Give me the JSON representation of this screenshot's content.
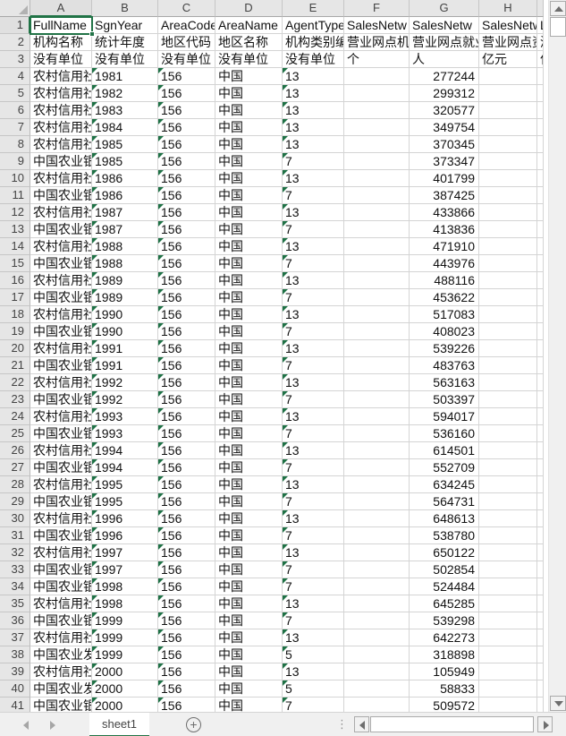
{
  "grid": {
    "column_letters": [
      "A",
      "B",
      "C",
      "D",
      "E",
      "F",
      "G",
      "H"
    ],
    "selected_cell": "A1",
    "rows_visible": {
      "first": 1,
      "last": 41
    },
    "field_row": [
      "FullName",
      "SgnYear",
      "AreaCode",
      "AreaName",
      "AgentType",
      "SalesNetw",
      "SalesNetw",
      "SalesNetw",
      "L"
    ],
    "label_row": [
      "机构名称",
      "统计年度",
      "地区代码",
      "地区名称",
      "机构类别编码",
      "营业网点机构数",
      "营业网点就业人数",
      "营业网点资产",
      "涉"
    ],
    "unit_row": [
      "没有单位",
      "没有单位",
      "没有单位",
      "没有单位",
      "没有单位",
      "个",
      "人",
      "亿元",
      "亿"
    ],
    "data_rows": [
      [
        "农村信用社",
        "1981",
        "156",
        "中国",
        "13",
        "",
        "277244",
        "",
        ""
      ],
      [
        "农村信用社",
        "1982",
        "156",
        "中国",
        "13",
        "",
        "299312",
        "",
        ""
      ],
      [
        "农村信用社",
        "1983",
        "156",
        "中国",
        "13",
        "",
        "320577",
        "",
        ""
      ],
      [
        "农村信用社",
        "1984",
        "156",
        "中国",
        "13",
        "",
        "349754",
        "",
        ""
      ],
      [
        "农村信用社",
        "1985",
        "156",
        "中国",
        "13",
        "",
        "370345",
        "",
        ""
      ],
      [
        "中国农业银行",
        "1985",
        "156",
        "中国",
        "7",
        "",
        "373347",
        "",
        ""
      ],
      [
        "农村信用社",
        "1986",
        "156",
        "中国",
        "13",
        "",
        "401799",
        "",
        ""
      ],
      [
        "中国农业银行",
        "1986",
        "156",
        "中国",
        "7",
        "",
        "387425",
        "",
        ""
      ],
      [
        "农村信用社",
        "1987",
        "156",
        "中国",
        "13",
        "",
        "433866",
        "",
        ""
      ],
      [
        "中国农业银行",
        "1987",
        "156",
        "中国",
        "7",
        "",
        "413836",
        "",
        ""
      ],
      [
        "农村信用社",
        "1988",
        "156",
        "中国",
        "13",
        "",
        "471910",
        "",
        ""
      ],
      [
        "中国农业银行",
        "1988",
        "156",
        "中国",
        "7",
        "",
        "443976",
        "",
        ""
      ],
      [
        "农村信用社",
        "1989",
        "156",
        "中国",
        "13",
        "",
        "488116",
        "",
        ""
      ],
      [
        "中国农业银行",
        "1989",
        "156",
        "中国",
        "7",
        "",
        "453622",
        "",
        ""
      ],
      [
        "农村信用社",
        "1990",
        "156",
        "中国",
        "13",
        "",
        "517083",
        "",
        ""
      ],
      [
        "中国农业银行",
        "1990",
        "156",
        "中国",
        "7",
        "",
        "408023",
        "",
        ""
      ],
      [
        "农村信用社",
        "1991",
        "156",
        "中国",
        "13",
        "",
        "539226",
        "",
        ""
      ],
      [
        "中国农业银行",
        "1991",
        "156",
        "中国",
        "7",
        "",
        "483763",
        "",
        ""
      ],
      [
        "农村信用社",
        "1992",
        "156",
        "中国",
        "13",
        "",
        "563163",
        "",
        ""
      ],
      [
        "中国农业银行",
        "1992",
        "156",
        "中国",
        "7",
        "",
        "503397",
        "",
        ""
      ],
      [
        "农村信用社",
        "1993",
        "156",
        "中国",
        "13",
        "",
        "594017",
        "",
        ""
      ],
      [
        "中国农业银行",
        "1993",
        "156",
        "中国",
        "7",
        "",
        "536160",
        "",
        ""
      ],
      [
        "农村信用社",
        "1994",
        "156",
        "中国",
        "13",
        "",
        "614501",
        "",
        ""
      ],
      [
        "中国农业银行",
        "1994",
        "156",
        "中国",
        "7",
        "",
        "552709",
        "",
        ""
      ],
      [
        "农村信用社",
        "1995",
        "156",
        "中国",
        "13",
        "",
        "634245",
        "",
        ""
      ],
      [
        "中国农业银行",
        "1995",
        "156",
        "中国",
        "7",
        "",
        "564731",
        "",
        ""
      ],
      [
        "农村信用社",
        "1996",
        "156",
        "中国",
        "13",
        "",
        "648613",
        "",
        ""
      ],
      [
        "中国农业银行",
        "1996",
        "156",
        "中国",
        "7",
        "",
        "538780",
        "",
        ""
      ],
      [
        "农村信用社",
        "1997",
        "156",
        "中国",
        "13",
        "",
        "650122",
        "",
        ""
      ],
      [
        "中国农业银行",
        "1997",
        "156",
        "中国",
        "7",
        "",
        "502854",
        "",
        ""
      ],
      [
        "中国农业银行",
        "1998",
        "156",
        "中国",
        "7",
        "",
        "524484",
        "",
        ""
      ],
      [
        "农村信用社",
        "1998",
        "156",
        "中国",
        "13",
        "",
        "645285",
        "",
        ""
      ],
      [
        "中国农业银行",
        "1999",
        "156",
        "中国",
        "7",
        "",
        "539298",
        "",
        ""
      ],
      [
        "农村信用社",
        "1999",
        "156",
        "中国",
        "13",
        "",
        "642273",
        "",
        ""
      ],
      [
        "中国农业发展银行",
        "1999",
        "156",
        "中国",
        "5",
        "",
        "318898",
        "",
        ""
      ],
      [
        "农村信用社",
        "2000",
        "156",
        "中国",
        "13",
        "",
        "105949",
        "",
        ""
      ],
      [
        "中国农业发展银行",
        "2000",
        "156",
        "中国",
        "5",
        "",
        "58833",
        "",
        ""
      ],
      [
        "中国农业银行",
        "2000",
        "156",
        "中国",
        "7",
        "",
        "509572",
        "",
        ""
      ]
    ]
  },
  "sheet_bar": {
    "active_tab": "sheet1",
    "add_sheet_label": "+"
  },
  "icons": {
    "drag_dots": "⋮"
  },
  "colors": {
    "accent_green": "#217346",
    "error_triangle_green": "#1E7145",
    "header_bg": "#E6E6E6",
    "gridline": "#D4D4D4"
  }
}
